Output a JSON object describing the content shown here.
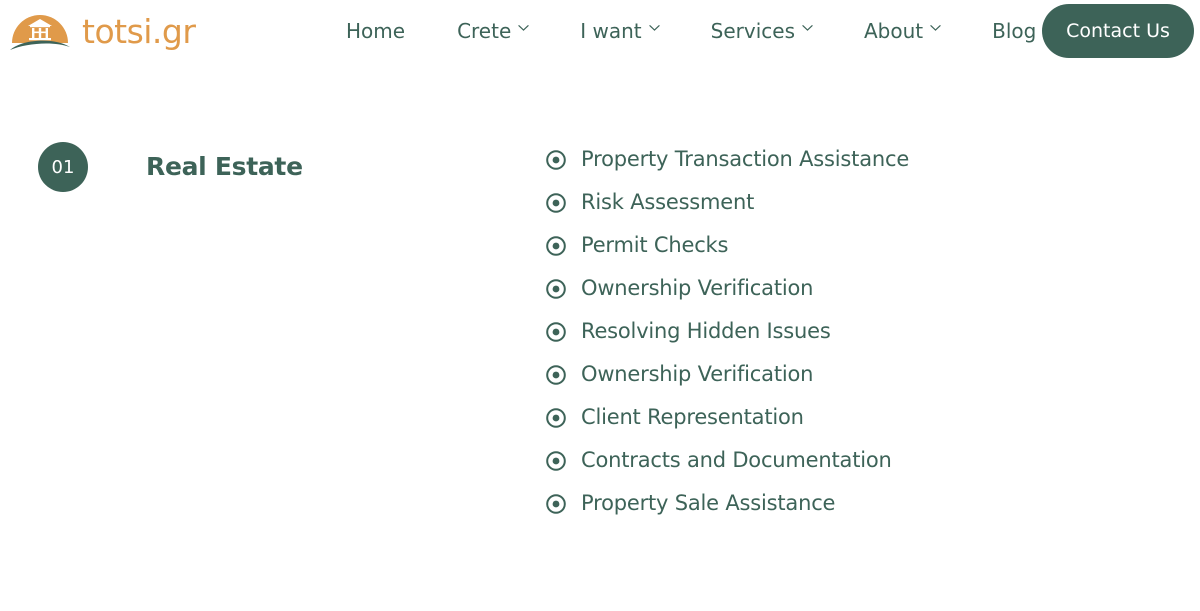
{
  "brand": {
    "wordmark": "totsi.gr",
    "logo_icon": "sun-dome-house-logo",
    "colors": {
      "orange": "#e09a4a",
      "teal": "#3d6358"
    }
  },
  "nav": {
    "items": [
      {
        "label": "Home",
        "has_dropdown": false
      },
      {
        "label": "Crete",
        "has_dropdown": true
      },
      {
        "label": "I want",
        "has_dropdown": true
      },
      {
        "label": "Services",
        "has_dropdown": true
      },
      {
        "label": "About",
        "has_dropdown": true
      },
      {
        "label": "Blog",
        "has_dropdown": false
      }
    ],
    "cta": {
      "label": "Contact Us"
    }
  },
  "service_block": {
    "index": "01",
    "title": "Real Estate",
    "features": [
      {
        "label": "Property Transaction Assistance"
      },
      {
        "label": "Risk Assessment"
      },
      {
        "label": "Permit Checks"
      },
      {
        "label": "Ownership Verification"
      },
      {
        "label": "Resolving Hidden Issues"
      },
      {
        "label": "Ownership Verification"
      },
      {
        "label": "Client Representation"
      },
      {
        "label": "Contracts and Documentation"
      },
      {
        "label": "Property Sale Assistance"
      }
    ]
  }
}
